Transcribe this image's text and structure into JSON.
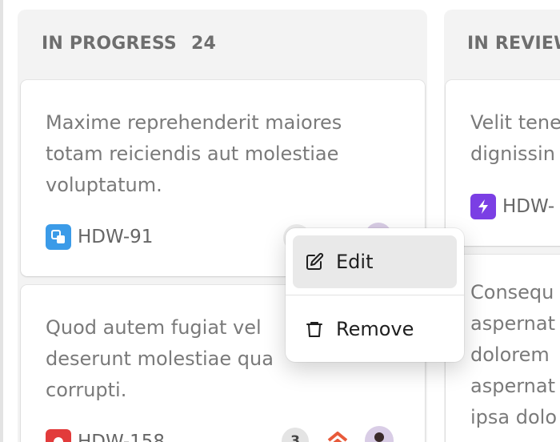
{
  "columns": [
    {
      "title": "IN PROGRESS",
      "count": "24",
      "cards": [
        {
          "title_lines": [
            "Maxime reprehenderit maiores",
            "totam reiciendis aut molestiae",
            "voluptatum."
          ],
          "key": "HDW-91",
          "type_icon": "subtask-icon",
          "type_color": "#3b9be8"
        },
        {
          "title_lines": [
            "Quod autem fugiat vel",
            "deserunt molestiae qua",
            "corrupti."
          ],
          "key": "HDW-158",
          "type_icon": "bug-icon",
          "type_color": "#e23b3b",
          "comment_count": "3",
          "priority_icon": "priority-highest-icon",
          "priority_color": "#e85a3a"
        }
      ]
    },
    {
      "title": "IN REVIEW",
      "cards": [
        {
          "title_lines": [
            "Velit tene",
            "dignissin"
          ],
          "key": "HDW-",
          "type_icon": "lightning-icon",
          "type_color": "#7b3fe4"
        },
        {
          "title_lines": [
            "Consequ",
            "aspernat",
            "dolorem",
            "aspernat",
            "ipsa dolo"
          ]
        }
      ]
    }
  ],
  "context_menu": {
    "items": [
      {
        "label": "Edit",
        "icon": "edit-icon"
      },
      {
        "label": "Remove",
        "icon": "trash-icon"
      }
    ]
  }
}
